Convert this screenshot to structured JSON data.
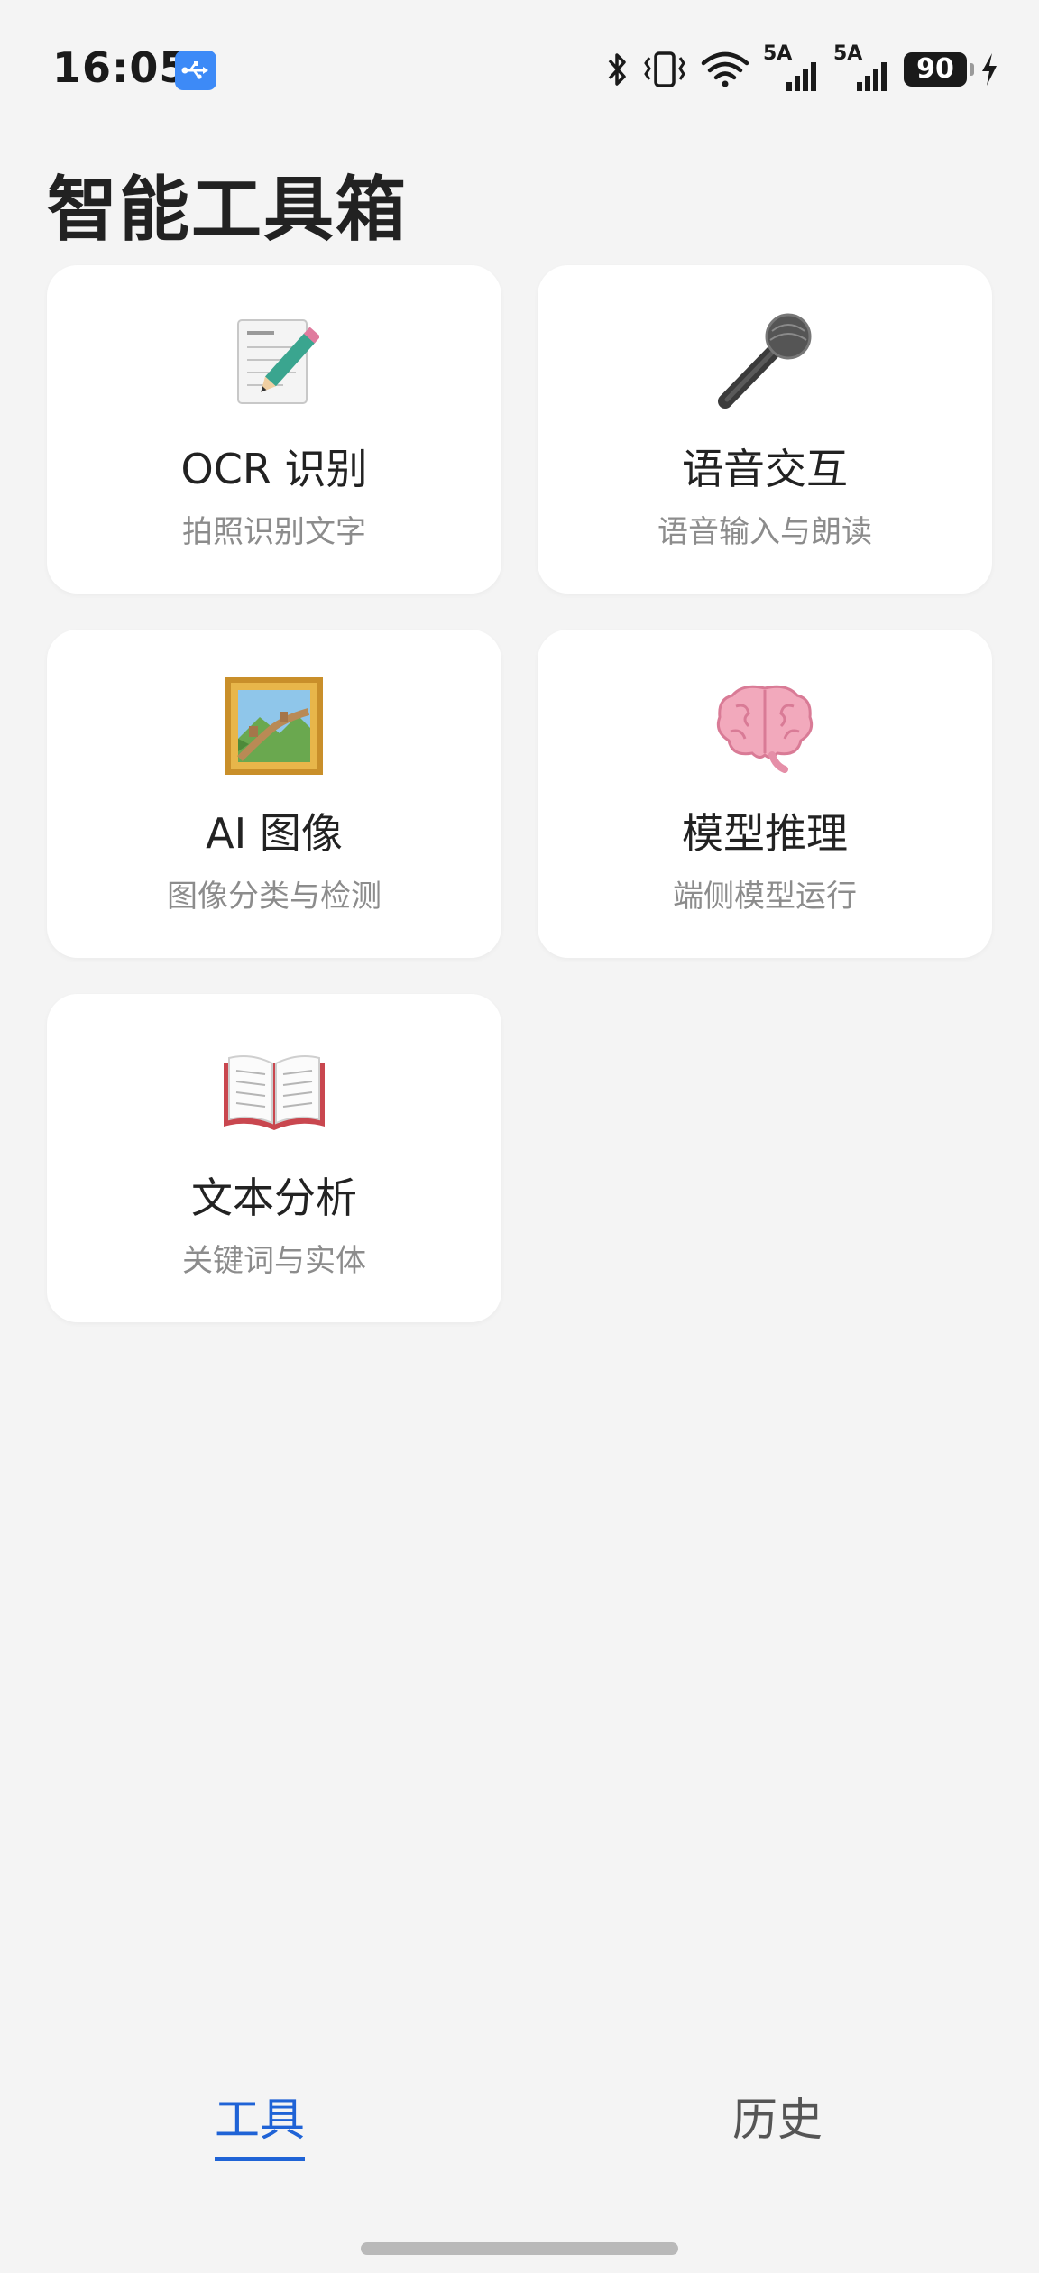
{
  "status_bar": {
    "time": "16:05",
    "usb_icon": "usb-icon",
    "network_1": "5A",
    "network_2": "5A",
    "battery": "90"
  },
  "page": {
    "title": "智能工具箱"
  },
  "tools": [
    {
      "title": "OCR 识别",
      "subtitle": "拍照识别文字",
      "icon": "memo-icon"
    },
    {
      "title": "语音交互",
      "subtitle": "语音输入与朗读",
      "icon": "microphone-icon"
    },
    {
      "title": "AI 图像",
      "subtitle": "图像分类与检测",
      "icon": "framed-picture-icon"
    },
    {
      "title": "模型推理",
      "subtitle": "端侧模型运行",
      "icon": "brain-icon"
    },
    {
      "title": "文本分析",
      "subtitle": "关键词与实体",
      "icon": "open-book-icon"
    }
  ],
  "tabs": [
    {
      "label": "工具",
      "active": true
    },
    {
      "label": "历史",
      "active": false
    }
  ],
  "colors": {
    "accent": "#1f63d6",
    "background": "#f4f4f4",
    "card": "#ffffff",
    "subtitle": "#8c8c8c"
  }
}
